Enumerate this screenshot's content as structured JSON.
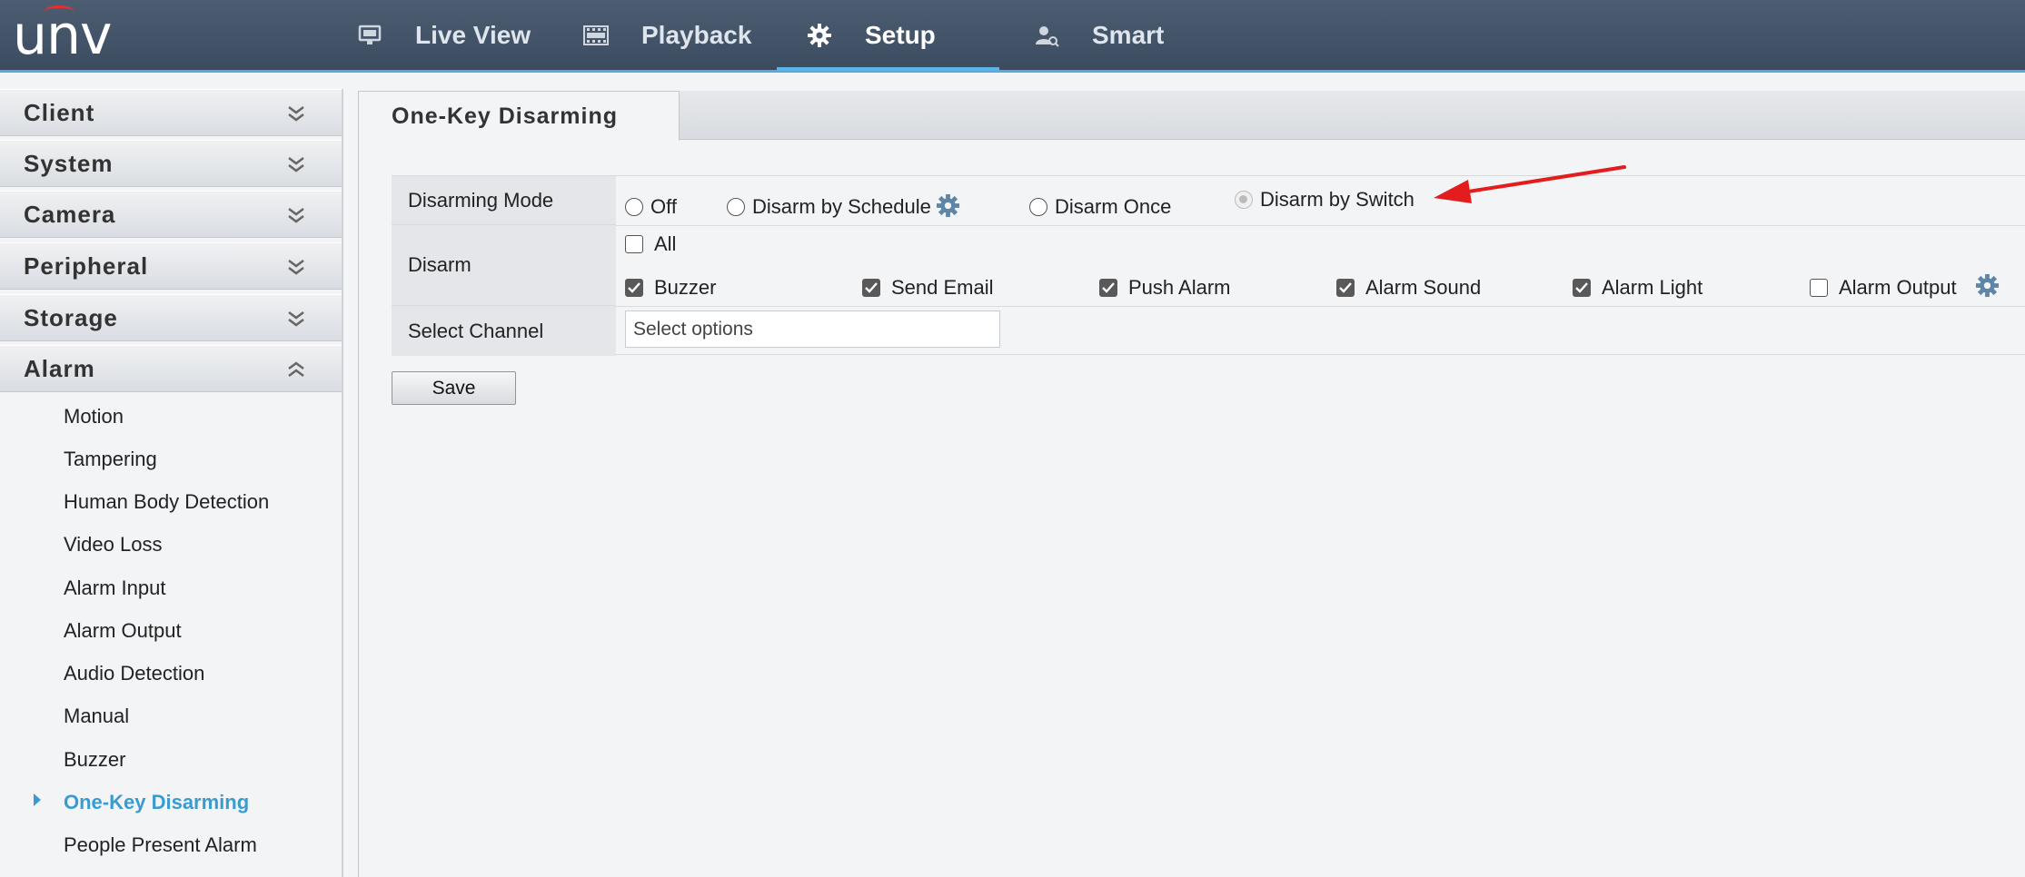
{
  "brand": {
    "logo_text": "unv"
  },
  "nav": {
    "items": [
      {
        "label": "Live View",
        "icon": "monitor-icon"
      },
      {
        "label": "Playback",
        "icon": "film-icon"
      },
      {
        "label": "Setup",
        "icon": "gear-icon",
        "active": true
      },
      {
        "label": "Smart",
        "icon": "person-search-icon"
      }
    ]
  },
  "sidebar": {
    "sections": [
      {
        "label": "Client",
        "expanded": false
      },
      {
        "label": "System",
        "expanded": false
      },
      {
        "label": "Camera",
        "expanded": false
      },
      {
        "label": "Peripheral",
        "expanded": false
      },
      {
        "label": "Storage",
        "expanded": false
      },
      {
        "label": "Alarm",
        "expanded": true
      }
    ],
    "alarm_items": [
      "Motion",
      "Tampering",
      "Human Body Detection",
      "Video Loss",
      "Alarm Input",
      "Alarm Output",
      "Audio Detection",
      "Manual",
      "Buzzer",
      "One-Key Disarming",
      "People Present Alarm"
    ],
    "active_item": "One-Key Disarming"
  },
  "tab": {
    "title": "One-Key Disarming"
  },
  "form": {
    "mode_label": "Disarming Mode",
    "mode_options": [
      "Off",
      "Disarm by Schedule",
      "Disarm Once",
      "Disarm by Switch"
    ],
    "mode_selected": "Disarm by Switch",
    "disarm_label": "Disarm",
    "all_label": "All",
    "all_checked": false,
    "disarm_options": [
      {
        "label": "Buzzer",
        "checked": true
      },
      {
        "label": "Send Email",
        "checked": true
      },
      {
        "label": "Push Alarm",
        "checked": true
      },
      {
        "label": "Alarm Sound",
        "checked": true
      },
      {
        "label": "Alarm Light",
        "checked": true
      },
      {
        "label": "Alarm Output",
        "checked": false
      }
    ],
    "channel_label": "Select Channel",
    "channel_placeholder": "Select options",
    "save_label": "Save"
  },
  "colors": {
    "topbar": "#46576b",
    "accent": "#3a9bd1",
    "annotation_arrow": "#e31d1d"
  }
}
